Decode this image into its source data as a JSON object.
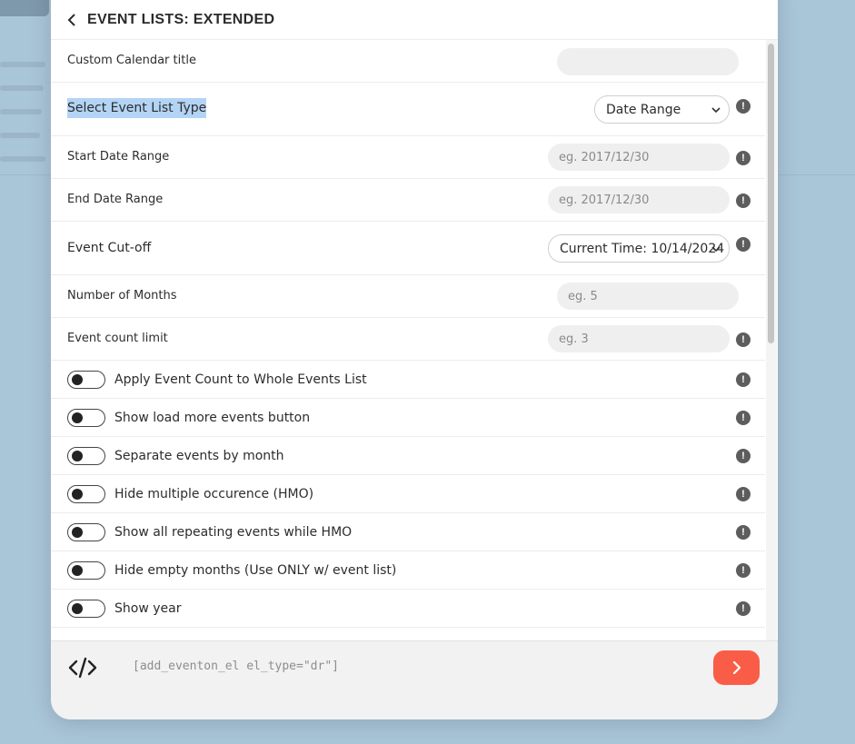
{
  "header": {
    "title": "EVENT LISTS: EXTENDED"
  },
  "fields": {
    "calendar_title": {
      "label": "Custom Calendar title",
      "value": "",
      "placeholder": ""
    },
    "list_type": {
      "label": "Select Event List Type",
      "value": "Date Range"
    },
    "start_date": {
      "label": "Start Date Range",
      "placeholder": "eg. 2017/12/30"
    },
    "end_date": {
      "label": "End Date Range",
      "placeholder": "eg. 2017/12/30"
    },
    "cutoff": {
      "label": "Event Cut-off",
      "value": "Current Time: 10/14/2024"
    },
    "months": {
      "label": "Number of Months",
      "placeholder": "eg. 5"
    },
    "count_limit": {
      "label": "Event count limit",
      "placeholder": "eg. 3"
    }
  },
  "info_glyph": "!",
  "toggles": [
    {
      "label": "Apply Event Count to Whole Events List",
      "on": false
    },
    {
      "label": "Show load more events button",
      "on": false
    },
    {
      "label": "Separate events by month",
      "on": false
    },
    {
      "label": "Hide multiple occurence (HMO)",
      "on": false
    },
    {
      "label": "Show all repeating events while HMO",
      "on": false
    },
    {
      "label": "Hide empty months (Use ONLY w/ event list)",
      "on": false
    },
    {
      "label": "Show year",
      "on": false
    }
  ],
  "footer": {
    "shortcode": "[add_eventon_el el_type=\"dr\"]"
  },
  "colors": {
    "accent": "#fa5d47",
    "selection": "#b3d4f5",
    "backdrop": "#a9c5d8"
  }
}
